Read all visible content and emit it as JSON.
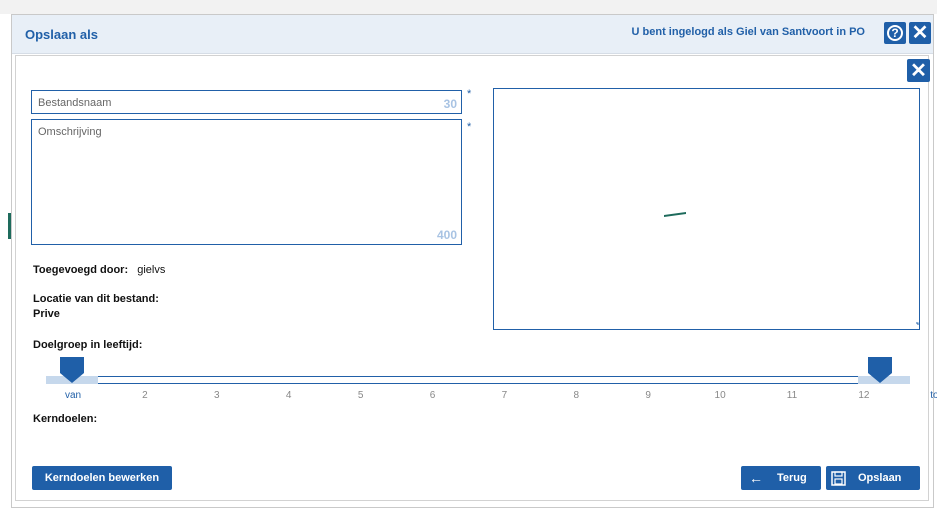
{
  "dialog": {
    "title": "Opslaan als",
    "login_text": "U bent ingelogd als Giel van Santvoort in PO"
  },
  "form": {
    "filename": {
      "label": "Bestandsnaam",
      "max_length": "30",
      "required_mark": "*"
    },
    "description": {
      "label": "Omschrijving",
      "max_length": "400",
      "required_mark": "*"
    },
    "added_by": {
      "label": "Toegevoegd door:",
      "value": "gielvs"
    },
    "location": {
      "label": "Locatie van dit bestand:",
      "value": "Prive"
    },
    "age_group": {
      "label": "Doelgroep in leeftijd:",
      "ticks": [
        "van",
        "2",
        "3",
        "4",
        "5",
        "6",
        "7",
        "8",
        "9",
        "10",
        "11",
        "12",
        "tot"
      ]
    },
    "core_goals": {
      "label": "Kerndoelen:"
    }
  },
  "buttons": {
    "edit_core_goals": "Kerndoelen bewerken",
    "back": "Terug",
    "save": "Opslaan"
  },
  "icons": {
    "help": "help-icon",
    "close": "close-icon",
    "arrow_left": "arrow-left-icon",
    "save": "floppy-disk-icon"
  },
  "colors": {
    "accent": "#1f5fa8",
    "header_bg": "#e8eff7",
    "slider_track": "#c6d8ec"
  }
}
